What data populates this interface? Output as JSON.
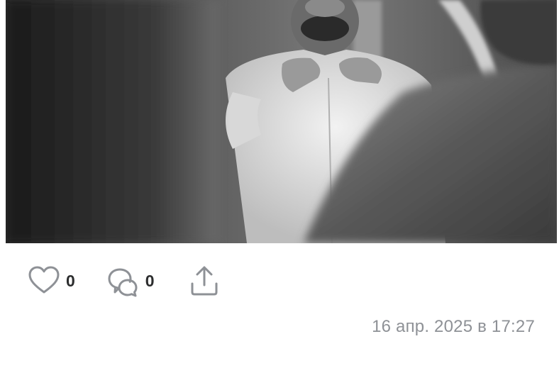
{
  "post": {
    "photo": {
      "description_icon": "photo-image"
    },
    "actions": {
      "like": {
        "icon": "heart-icon",
        "count": "0"
      },
      "comment": {
        "icon": "comment-bubbles-icon",
        "count": "0"
      },
      "share": {
        "icon": "share-upload-icon"
      }
    },
    "timestamp": "16 апр. 2025 в 17:27"
  },
  "colors": {
    "icon": "#8e9196",
    "count_text": "#2c2d2e",
    "timestamp_text": "#8e9196",
    "background": "#ffffff"
  }
}
